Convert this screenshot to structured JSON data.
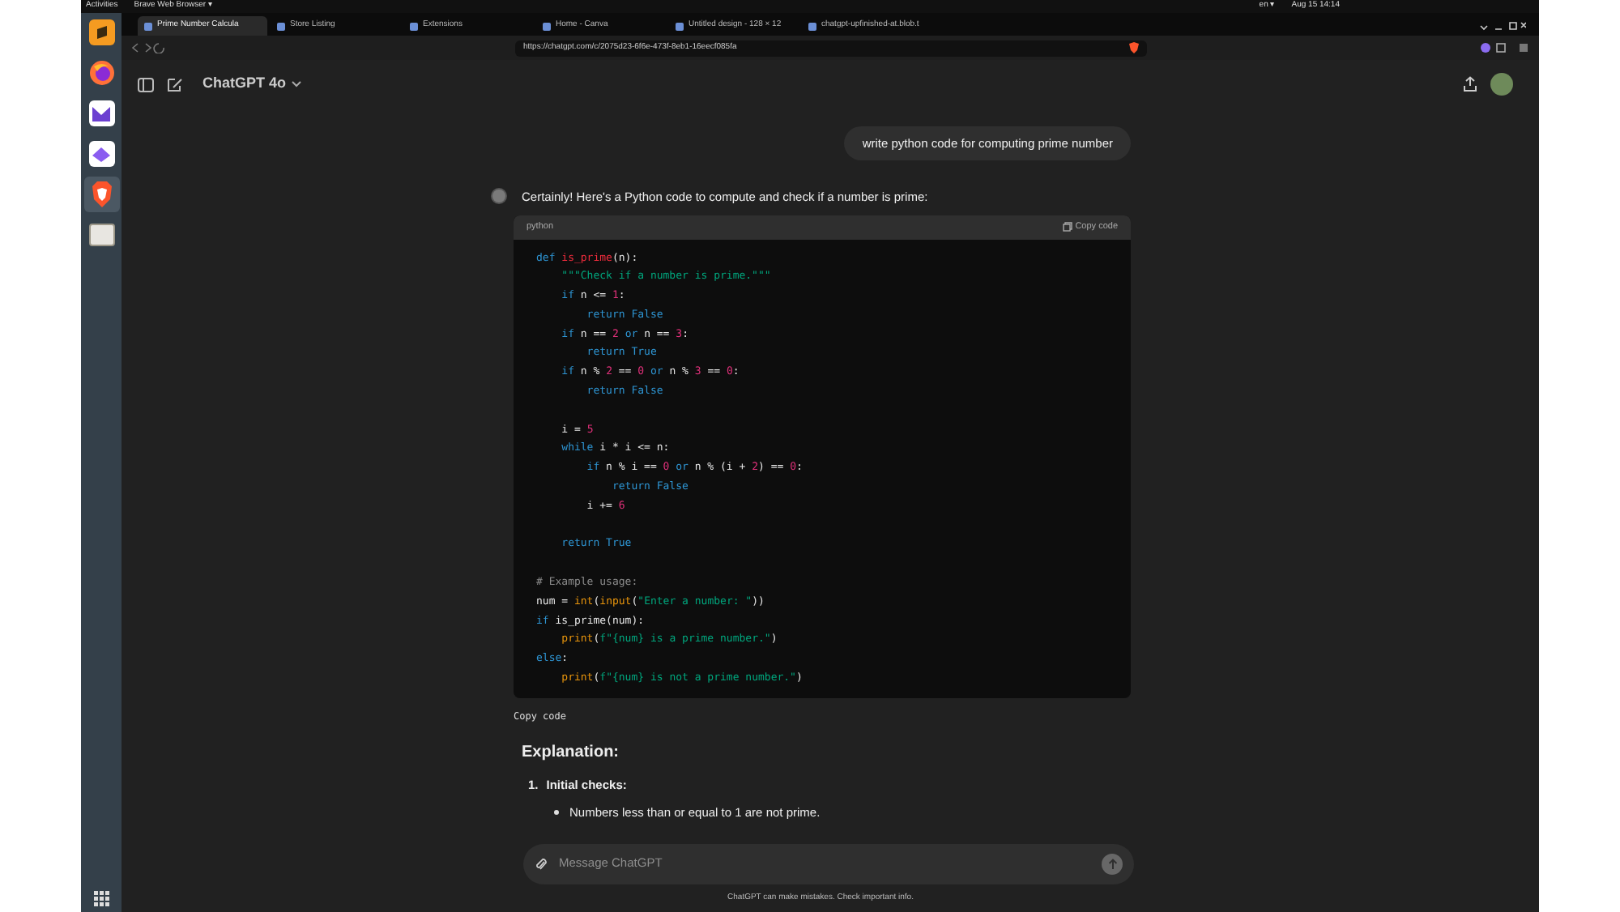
{
  "system_bar": {
    "activities": "Activities",
    "app_menu": "Brave Web Browser ▾",
    "clock": "Aug 15 14:14",
    "input_source": "en ▾"
  },
  "dock": {
    "apps": [
      {
        "kind": "sublime",
        "selected": false
      },
      {
        "kind": "firefox",
        "selected": false
      },
      {
        "kind": "mail",
        "selected": false
      },
      {
        "kind": "cloud",
        "selected": false
      },
      {
        "kind": "brave",
        "selected": true
      },
      {
        "kind": "files",
        "selected": false
      }
    ]
  },
  "tabs": [
    {
      "label": "Prime Number Calcula",
      "selected": true
    },
    {
      "label": "Store Listing",
      "selected": false
    },
    {
      "label": "Extensions",
      "selected": false
    },
    {
      "label": "Home - Canva",
      "selected": false
    },
    {
      "label": "Untitled design - 128 × 12",
      "selected": false
    },
    {
      "label": "chatgpt-upfinished-at.blob.t",
      "selected": false
    }
  ],
  "address_bar": {
    "url": "https://chatgpt.com/c/2075d23-6f6e-473f-8eb1-16eecf085fa"
  },
  "chat": {
    "model": "ChatGPT 4o",
    "user_message": "write python code for computing prime number",
    "assistant_intro": "Certainly! Here's a Python code to compute and check if a number is prime:",
    "code_block": {
      "language": "python",
      "copy_label": "Copy code",
      "lines": [
        {
          "tokens": [
            {
              "kind": "kw",
              "t": "def "
            },
            {
              "kind": "fn",
              "t": "is_prime"
            },
            {
              "kind": "p",
              "t": "(n):"
            }
          ]
        },
        {
          "tokens": [
            {
              "kind": "str",
              "t": "    \"\"\"Check if a number is prime.\"\"\""
            }
          ]
        },
        {
          "tokens": [
            {
              "kind": "kw",
              "t": "    if "
            },
            {
              "kind": "p",
              "t": "n <= "
            },
            {
              "kind": "num",
              "t": "1"
            },
            {
              "kind": "p",
              "t": ":"
            }
          ]
        },
        {
          "tokens": [
            {
              "kind": "kw",
              "t": "        return False"
            }
          ]
        },
        {
          "tokens": [
            {
              "kind": "kw",
              "t": "    if "
            },
            {
              "kind": "p",
              "t": "n == "
            },
            {
              "kind": "num",
              "t": "2"
            },
            {
              "kind": "kw",
              "t": " or "
            },
            {
              "kind": "p",
              "t": "n == "
            },
            {
              "kind": "num",
              "t": "3"
            },
            {
              "kind": "p",
              "t": ":"
            }
          ]
        },
        {
          "tokens": [
            {
              "kind": "kw",
              "t": "        return True"
            }
          ]
        },
        {
          "tokens": [
            {
              "kind": "kw",
              "t": "    if "
            },
            {
              "kind": "p",
              "t": "n % "
            },
            {
              "kind": "num",
              "t": "2"
            },
            {
              "kind": "p",
              "t": " == "
            },
            {
              "kind": "num",
              "t": "0"
            },
            {
              "kind": "kw",
              "t": " or "
            },
            {
              "kind": "p",
              "t": "n % "
            },
            {
              "kind": "num",
              "t": "3"
            },
            {
              "kind": "p",
              "t": " == "
            },
            {
              "kind": "num",
              "t": "0"
            },
            {
              "kind": "p",
              "t": ":"
            }
          ]
        },
        {
          "tokens": [
            {
              "kind": "kw",
              "t": "        return False"
            }
          ]
        },
        {
          "gap_before": true,
          "tokens": [
            {
              "kind": "p",
              "t": "    i = "
            },
            {
              "kind": "num",
              "t": "5"
            }
          ]
        },
        {
          "tokens": [
            {
              "kind": "kw",
              "t": "    while "
            },
            {
              "kind": "p",
              "t": "i * i <= n:"
            }
          ]
        },
        {
          "tokens": [
            {
              "kind": "kw",
              "t": "        if "
            },
            {
              "kind": "p",
              "t": "n % i == "
            },
            {
              "kind": "num",
              "t": "0"
            },
            {
              "kind": "kw",
              "t": " or "
            },
            {
              "kind": "p",
              "t": "n % (i + "
            },
            {
              "kind": "num",
              "t": "2"
            },
            {
              "kind": "p",
              "t": ") == "
            },
            {
              "kind": "num",
              "t": "0"
            },
            {
              "kind": "p",
              "t": ":"
            }
          ]
        },
        {
          "tokens": [
            {
              "kind": "kw",
              "t": "            return False"
            }
          ]
        },
        {
          "tokens": [
            {
              "kind": "p",
              "t": "        i += "
            },
            {
              "kind": "num",
              "t": "6"
            }
          ]
        },
        {
          "gap_before": true,
          "tokens": [
            {
              "kind": "kw",
              "t": "    return True"
            }
          ]
        },
        {
          "gap_before": true,
          "tokens": [
            {
              "kind": "com",
              "t": "# Example usage:"
            }
          ]
        },
        {
          "tokens": [
            {
              "kind": "p",
              "t": "num = "
            },
            {
              "kind": "bi",
              "t": "int"
            },
            {
              "kind": "p",
              "t": "("
            },
            {
              "kind": "bi",
              "t": "input"
            },
            {
              "kind": "p",
              "t": "("
            },
            {
              "kind": "str",
              "t": "\"Enter a number: \""
            },
            {
              "kind": "p",
              "t": "))"
            }
          ]
        },
        {
          "tokens": [
            {
              "kind": "kw",
              "t": "if "
            },
            {
              "kind": "p",
              "t": "is_prime(num):"
            }
          ]
        },
        {
          "tokens": [
            {
              "kind": "bi",
              "t": "    print"
            },
            {
              "kind": "p",
              "t": "("
            },
            {
              "kind": "str",
              "t": "f\"{num} is a prime number.\""
            },
            {
              "kind": "p",
              "t": ")"
            }
          ]
        },
        {
          "tokens": [
            {
              "kind": "kw",
              "t": "else"
            },
            {
              "kind": "p",
              "t": ":"
            }
          ]
        },
        {
          "tokens": [
            {
              "kind": "bi",
              "t": "    print"
            },
            {
              "kind": "p",
              "t": "("
            },
            {
              "kind": "str",
              "t": "f\"{num} is not a prime number.\""
            },
            {
              "kind": "p",
              "t": ")"
            }
          ]
        }
      ]
    },
    "after_code": "Copy code",
    "heading": "Explanation:",
    "steps": [
      {
        "number": "1.",
        "title": "Initial checks:",
        "bullets": [
          "Numbers less than or equal to 1 are not prime."
        ]
      }
    ],
    "composer": {
      "placeholder": "Message ChatGPT"
    },
    "disclaimer": "ChatGPT can make mistakes. Check important info."
  }
}
